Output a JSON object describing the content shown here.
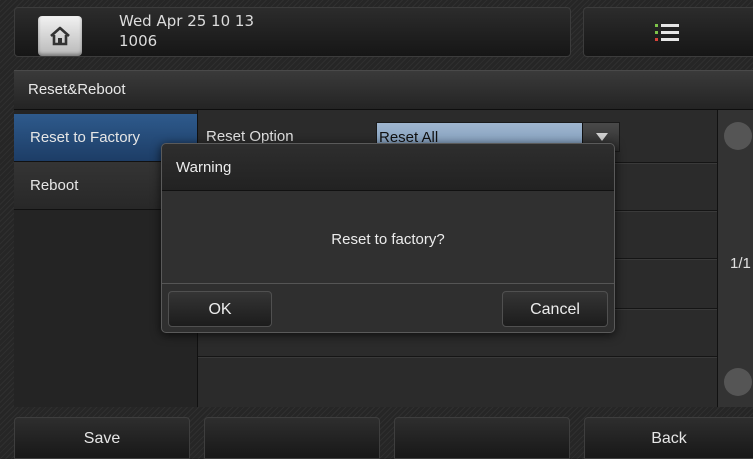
{
  "status_bar": {
    "datetime": "Wed Apr 25 10 13",
    "extension": "1006",
    "home_icon": "home-icon",
    "menu_icon": "menu-list-icon"
  },
  "title_bar": {
    "title": "Reset&Reboot"
  },
  "left_menu": {
    "items": [
      {
        "label": "Reset to Factory",
        "selected": true
      },
      {
        "label": "Reboot",
        "selected": false
      }
    ]
  },
  "content": {
    "option_label": "Reset Option",
    "option_value": "Reset All"
  },
  "pager": {
    "page": "1/1"
  },
  "dialog": {
    "title": "Warning",
    "message": "Reset to factory?",
    "ok_label": "OK",
    "cancel_label": "Cancel"
  },
  "softkeys": {
    "key1": "Save",
    "key2": "",
    "key3": "",
    "key4": "Back"
  },
  "colors": {
    "selected_item": "#2e5a8c",
    "select_field": "#9fb6cf"
  }
}
